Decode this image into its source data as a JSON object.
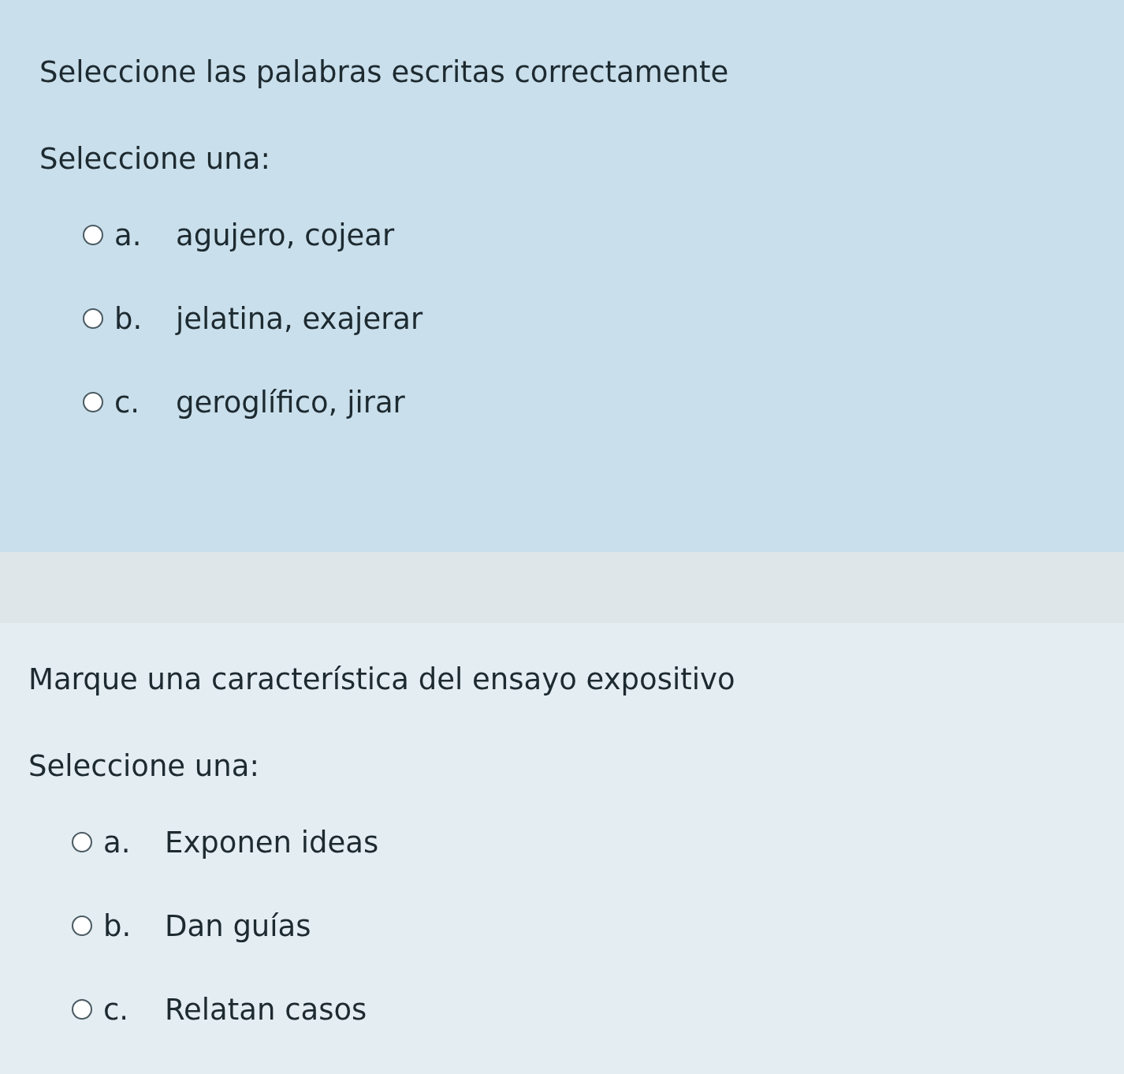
{
  "questions": [
    {
      "prompt": "Seleccione las palabras escritas correctamente",
      "instruction": "Seleccione una:",
      "options": [
        {
          "letter": "a.",
          "text": "agujero, cojear",
          "selected": false
        },
        {
          "letter": "b.",
          "text": "jelatina, exajerar",
          "selected": false
        },
        {
          "letter": "c.",
          "text": "geroglífico, jirar",
          "selected": false
        }
      ]
    },
    {
      "prompt": "Marque una característica del ensayo expositivo",
      "instruction": "Seleccione una:",
      "options": [
        {
          "letter": "a.",
          "text": "Exponen ideas",
          "selected": false
        },
        {
          "letter": "b.",
          "text": "Dan guías",
          "selected": false
        },
        {
          "letter": "c.",
          "text": "Relatan casos",
          "selected": false
        }
      ]
    }
  ]
}
